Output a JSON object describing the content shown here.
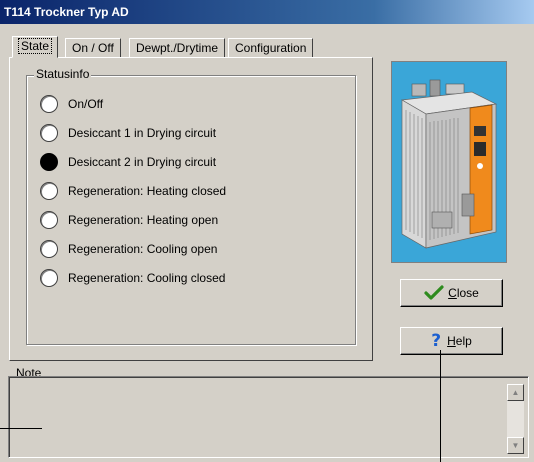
{
  "window": {
    "title": "T114 Trockner Typ AD"
  },
  "tabs": [
    {
      "label": "State",
      "active": true
    },
    {
      "label": "On / Off",
      "active": false
    },
    {
      "label": "Dewpt./Drytime",
      "active": false
    },
    {
      "label": "Configuration",
      "active": false
    }
  ],
  "statusinfo": {
    "label": "Statusinfo",
    "items": [
      {
        "label": "On/Off",
        "active": false
      },
      {
        "label": "Desiccant 1 in Drying circuit",
        "active": false
      },
      {
        "label": "Desiccant 2 in Drying circuit",
        "active": true
      },
      {
        "label": "Regeneration: Heating closed",
        "active": false
      },
      {
        "label": "Regeneration: Heating open",
        "active": false
      },
      {
        "label": "Regeneration: Cooling open",
        "active": false
      },
      {
        "label": "Regeneration: Cooling closed",
        "active": false
      }
    ]
  },
  "buttons": {
    "close": {
      "accel": "C",
      "rest": "lose",
      "icon": "checkmark-icon"
    },
    "help": {
      "accel": "H",
      "rest": "elp",
      "icon": "question-mark-icon"
    }
  },
  "note": {
    "accel": "N",
    "rest": "ote",
    "value": ""
  },
  "colors": {
    "titlebar": "#0a246a",
    "face": "#d4d0c8",
    "check": "#2e8b1e",
    "help": "#1b5fd0",
    "image_bg": "#3aa6d8",
    "machine_accent": "#f08a1c"
  }
}
